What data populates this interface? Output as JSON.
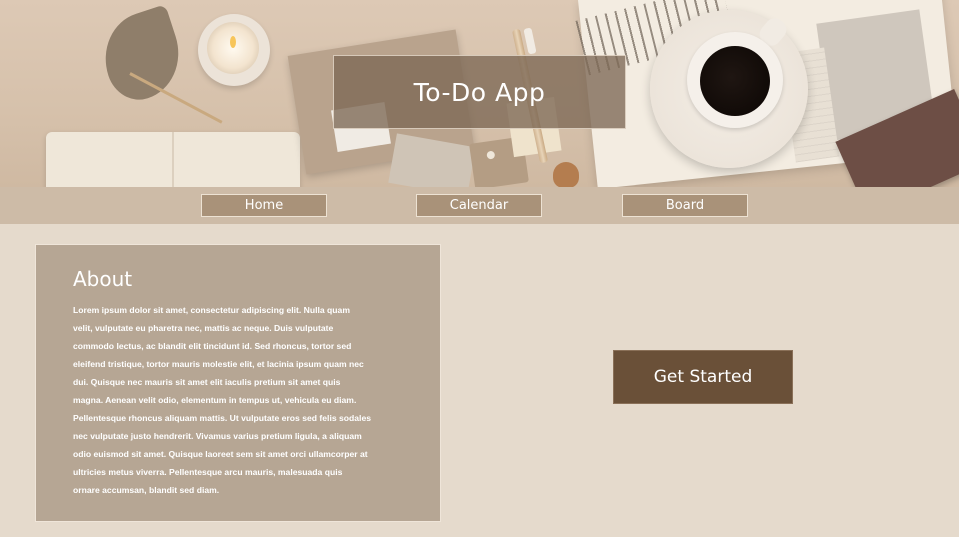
{
  "header": {
    "title": "To-Do App"
  },
  "nav": {
    "items": [
      {
        "label": "Home"
      },
      {
        "label": "Calendar"
      },
      {
        "label": "Board"
      }
    ]
  },
  "about": {
    "title": "About",
    "body": "Lorem ipsum dolor sit amet, consectetur adipiscing elit. Nulla quam velit, vulputate eu pharetra nec, mattis ac neque. Duis vulputate commodo lectus, ac blandit elit tincidunt id. Sed rhoncus, tortor sed eleifend tristique, tortor mauris molestie elit, et lacinia ipsum quam nec dui. Quisque nec mauris sit amet elit iaculis pretium sit amet quis magna. Aenean velit odio, elementum in tempus ut, vehicula eu diam. Pellentesque rhoncus aliquam mattis. Ut vulputate eros sed felis sodales nec vulputate justo hendrerit. Vivamus varius pretium ligula, a aliquam odio euismod sit amet. Quisque laoreet sem sit amet orci ullamcorper at ultricies metus viverra. Pellentesque arcu mauris, malesuada quis ornare accumsan, blandit sed diam."
  },
  "cta": {
    "label": "Get Started"
  },
  "colors": {
    "page_background": "#e5dacc",
    "nav_bar": "#cdbba7",
    "nav_button": "#a99279",
    "about_card": "#b6a694",
    "cta_button": "#6a5038",
    "title_box": "#7c6854"
  }
}
